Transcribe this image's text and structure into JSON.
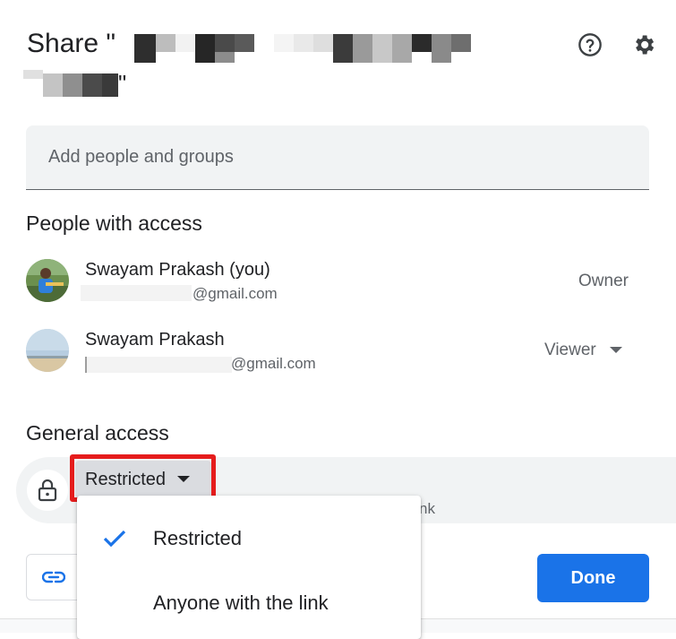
{
  "dialog": {
    "title_prefix": "Share \"",
    "title_suffix": "\"",
    "help_icon": "help-circle-icon",
    "settings_icon": "gear-icon"
  },
  "add_people": {
    "placeholder": "Add people and groups"
  },
  "people_section": {
    "heading": "People with access",
    "people": [
      {
        "name": "Swayam Prakash (you)",
        "email_visible": "@gmail.com",
        "role": "Owner"
      },
      {
        "name": "Swayam Prakash",
        "email_visible": "@gmail.com",
        "role": "Viewer"
      }
    ]
  },
  "general_access": {
    "heading": "General access",
    "selected": "Restricted",
    "partial_text": "nk",
    "lock_icon": "lock-icon"
  },
  "menu": {
    "items": [
      {
        "label": "Restricted",
        "checked": true
      },
      {
        "label": "Anyone with the link",
        "checked": false
      }
    ]
  },
  "footer": {
    "done_label": "Done",
    "copy_icon": "link-icon"
  },
  "colors": {
    "accent": "#1a73e8",
    "highlight_box": "#e51c1c",
    "field_bg": "#f1f3f4"
  }
}
